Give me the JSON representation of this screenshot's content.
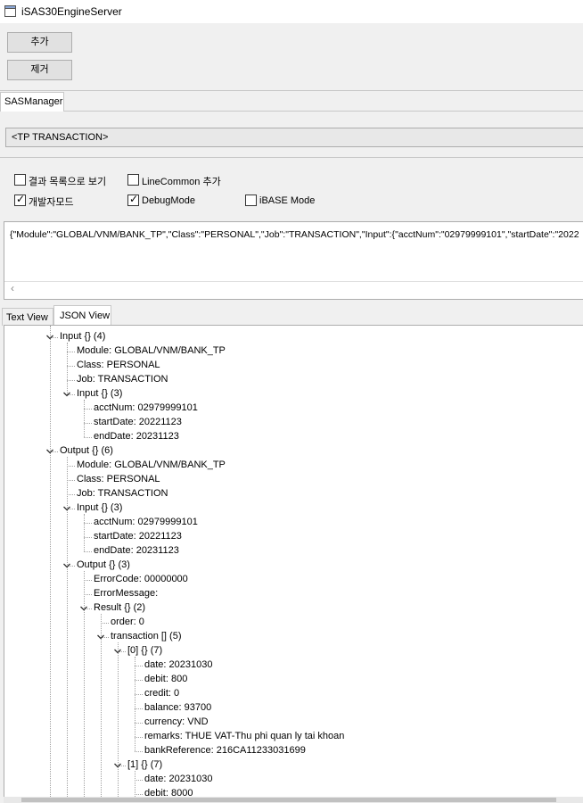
{
  "window": {
    "title": "iSAS30EngineServer"
  },
  "toolbar": {
    "add_label": "추가",
    "remove_label": "제거"
  },
  "main_tab": {
    "label": "SASManager"
  },
  "combo": {
    "value": "<TP TRANSACTION>"
  },
  "options": {
    "view_as_list": {
      "label": "결과 목록으로 보기",
      "checked": false
    },
    "line_common": {
      "label": "LineCommon 추가",
      "checked": false
    },
    "dev_mode": {
      "label": "개발자모드",
      "checked": true
    },
    "debug_mode": {
      "label": "DebugMode",
      "checked": true
    },
    "ibase_mode": {
      "label": "iBASE Mode",
      "checked": false
    }
  },
  "json_input": {
    "text": "{\"Module\":\"GLOBAL/VNM/BANK_TP\",\"Class\":\"PERSONAL\",\"Job\":\"TRANSACTION\",\"Input\":{\"acctNum\":\"02979999101\",\"startDate\":\"2022"
  },
  "view_tabs": {
    "text_view": "Text View",
    "json_view": "JSON View"
  },
  "tree": [
    {
      "text": "Input {} (4)",
      "depth": 0,
      "expandable": true
    },
    {
      "text": "Module: GLOBAL/VNM/BANK_TP",
      "depth": 1
    },
    {
      "text": "Class: PERSONAL",
      "depth": 1
    },
    {
      "text": "Job: TRANSACTION",
      "depth": 1
    },
    {
      "text": "Input {} (3)",
      "depth": 1,
      "expandable": true
    },
    {
      "text": "acctNum: 02979999101",
      "depth": 2
    },
    {
      "text": "startDate: 20221123",
      "depth": 2
    },
    {
      "text": "endDate: 20231123",
      "depth": 2
    },
    {
      "text": "Output {} (6)",
      "depth": 0,
      "expandable": true
    },
    {
      "text": "Module: GLOBAL/VNM/BANK_TP",
      "depth": 1
    },
    {
      "text": "Class: PERSONAL",
      "depth": 1
    },
    {
      "text": "Job: TRANSACTION",
      "depth": 1
    },
    {
      "text": "Input {} (3)",
      "depth": 1,
      "expandable": true
    },
    {
      "text": "acctNum: 02979999101",
      "depth": 2
    },
    {
      "text": "startDate: 20221123",
      "depth": 2
    },
    {
      "text": "endDate: 20231123",
      "depth": 2
    },
    {
      "text": "Output {} (3)",
      "depth": 1,
      "expandable": true
    },
    {
      "text": "ErrorCode: 00000000",
      "depth": 2
    },
    {
      "text": "ErrorMessage:",
      "depth": 2
    },
    {
      "text": "Result {} (2)",
      "depth": 2,
      "expandable": true
    },
    {
      "text": "order: 0",
      "depth": 3
    },
    {
      "text": "transaction [] (5)",
      "depth": 3,
      "expandable": true
    },
    {
      "text": "[0] {} (7)",
      "depth": 4,
      "expandable": true
    },
    {
      "text": "date: 20231030",
      "depth": 5
    },
    {
      "text": "debit: 800",
      "depth": 5
    },
    {
      "text": "credit: 0",
      "depth": 5
    },
    {
      "text": "balance: 93700",
      "depth": 5
    },
    {
      "text": "currency: VND",
      "depth": 5
    },
    {
      "text": "remarks: THUE VAT-Thu phi quan ly tai khoan",
      "depth": 5
    },
    {
      "text": "bankReference: 216CA11233031699",
      "depth": 5
    },
    {
      "text": "[1] {} (7)",
      "depth": 4,
      "expandable": true
    },
    {
      "text": "date: 20231030",
      "depth": 5
    },
    {
      "text": "debit: 8000",
      "depth": 5
    }
  ]
}
